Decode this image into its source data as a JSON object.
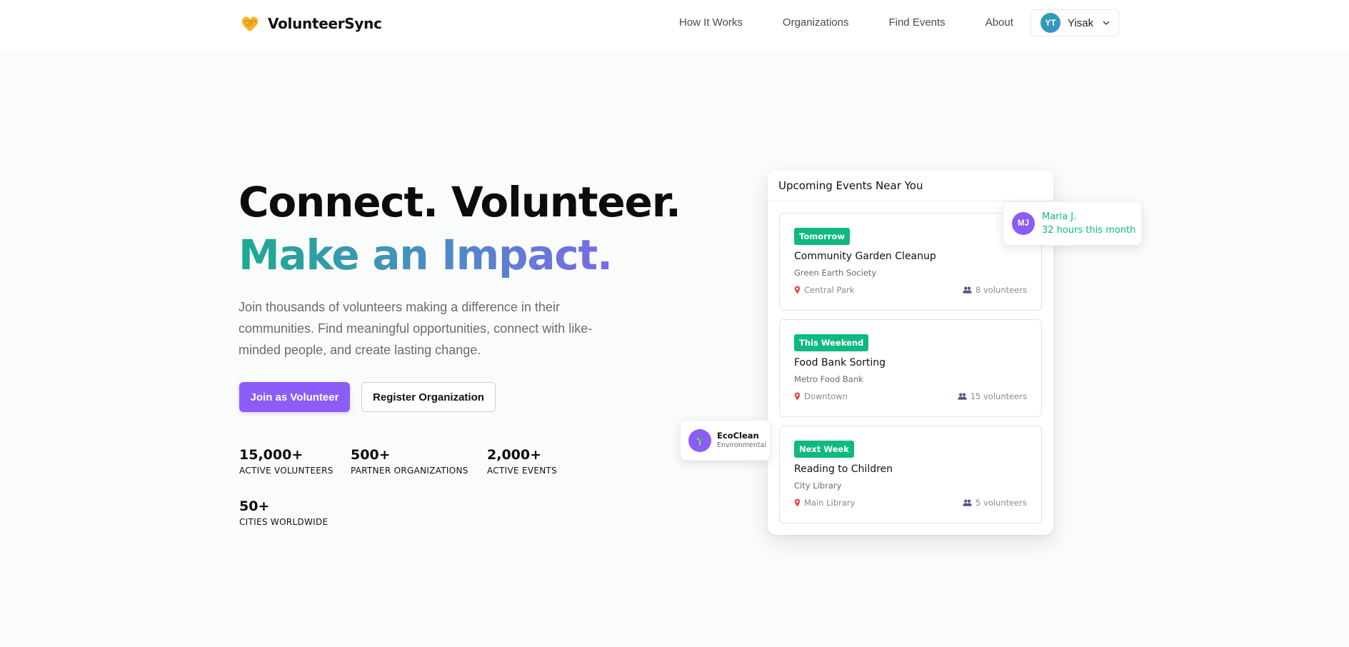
{
  "header": {
    "brand_name": "VolunteerSync",
    "brand_icon": "heart-handshake-icon",
    "nav": [
      {
        "label": "How It Works"
      },
      {
        "label": "Organizations"
      },
      {
        "label": "Find Events"
      },
      {
        "label": "About"
      }
    ],
    "user": {
      "initials": "YT",
      "name": "Yisak"
    }
  },
  "hero": {
    "title_line1": "Connect. Volunteer.",
    "title_line2": "Make an Impact.",
    "subtitle": "Join thousands of volunteers making a difference in their communities. Find meaningful opportunities, connect with like-minded people, and create lasting change.",
    "primary_button": "Join as Volunteer",
    "secondary_button": "Register Organization",
    "stats": [
      {
        "value": "15,000+",
        "label": "ACTIVE VOLUNTEERS"
      },
      {
        "value": "500+",
        "label": "PARTNER ORGANIZATIONS"
      },
      {
        "value": "2,000+",
        "label": "ACTIVE EVENTS"
      },
      {
        "value": "50+",
        "label": "CITIES WORLDWIDE"
      }
    ]
  },
  "events_panel": {
    "title": "Upcoming Events Near You",
    "events": [
      {
        "badge": "Tomorrow",
        "title": "Community Garden Cleanup",
        "org": "Green Earth Society",
        "location": "Central Park",
        "volunteers": "8 volunteers"
      },
      {
        "badge": "This Weekend",
        "title": "Food Bank Sorting",
        "org": "Metro Food Bank",
        "location": "Downtown",
        "volunteers": "15 volunteers"
      },
      {
        "badge": "Next Week",
        "title": "Reading to Children",
        "org": "City Library",
        "location": "Main Library",
        "volunteers": "5 volunteers"
      }
    ]
  },
  "floating": {
    "maria": {
      "initials": "MJ",
      "name": "Maria J.",
      "hours": "32 hours this month"
    },
    "eco": {
      "name": "EcoClean",
      "type": "Environmental",
      "icon": "seedling-icon"
    }
  },
  "colors": {
    "accent_purple": "#8b5cf6",
    "accent_green": "#10b981",
    "gradient_start": "#1daa8f",
    "gradient_end": "#8b5cf6"
  }
}
